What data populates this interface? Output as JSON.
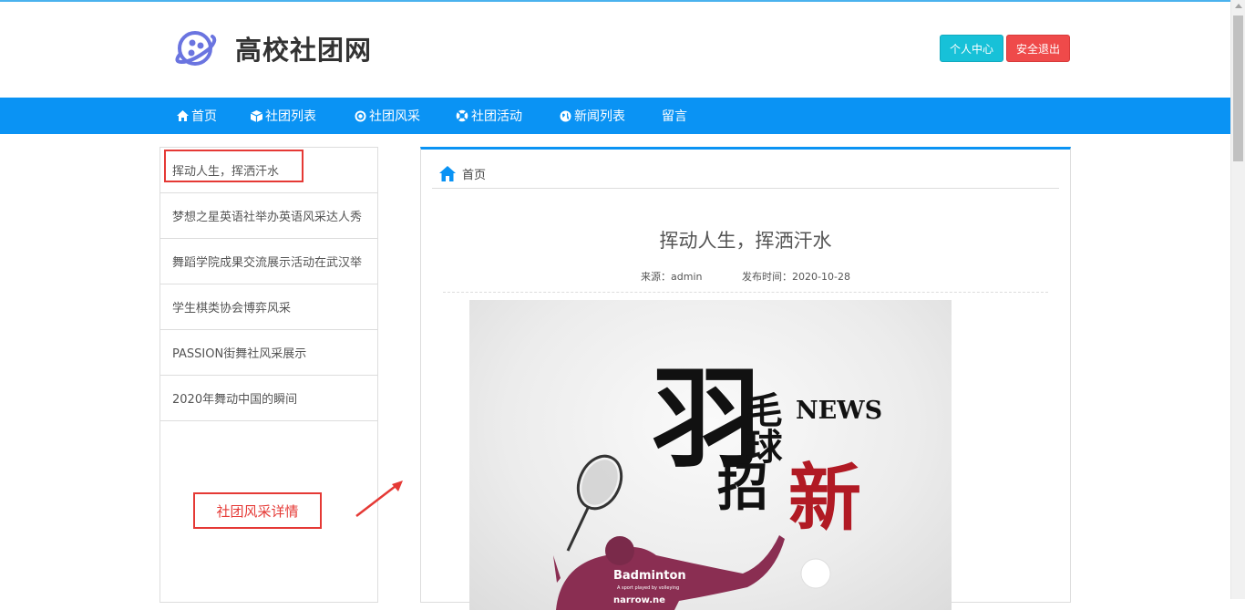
{
  "site": {
    "title": "高校社团网"
  },
  "header_buttons": {
    "user_center": "个人中心",
    "logout": "安全退出"
  },
  "nav": {
    "items": [
      {
        "label": "首页",
        "icon": "home-icon"
      },
      {
        "label": "社团列表",
        "icon": "cube-icon"
      },
      {
        "label": "社团风采",
        "icon": "target-icon"
      },
      {
        "label": "社团活动",
        "icon": "lifebuoy-icon"
      },
      {
        "label": "新闻列表",
        "icon": "globe-icon"
      },
      {
        "label": "留言",
        "icon": ""
      }
    ]
  },
  "sidebar": {
    "items": [
      "挥动人生，挥洒汗水",
      "梦想之星英语社举办英语风采达人秀",
      "舞蹈学院成果交流展示活动在武汉举",
      "学生棋类协会博弈风采",
      "PASSION街舞社风采展示",
      "2020年舞动中国的瞬间"
    ]
  },
  "annotation": {
    "label": "社团风采详情"
  },
  "breadcrumb": {
    "label": "首页"
  },
  "article": {
    "title": "挥动人生，挥洒汗水",
    "source": "来源：admin",
    "date": "发布时间：2020-10-28"
  },
  "poster": {
    "big_char_1": "羽",
    "chars_small": "毛球",
    "news": "NEWS",
    "char_zhao": "招",
    "char_xin": "新",
    "badminton": "Badminton",
    "small_text": "A sport played by volleying",
    "site": "narrow.ne"
  },
  "colors": {
    "nav_bg": "#0a93f4",
    "accent": "#17c1d8",
    "danger": "#ef4a4a",
    "highlight": "#e53935"
  }
}
